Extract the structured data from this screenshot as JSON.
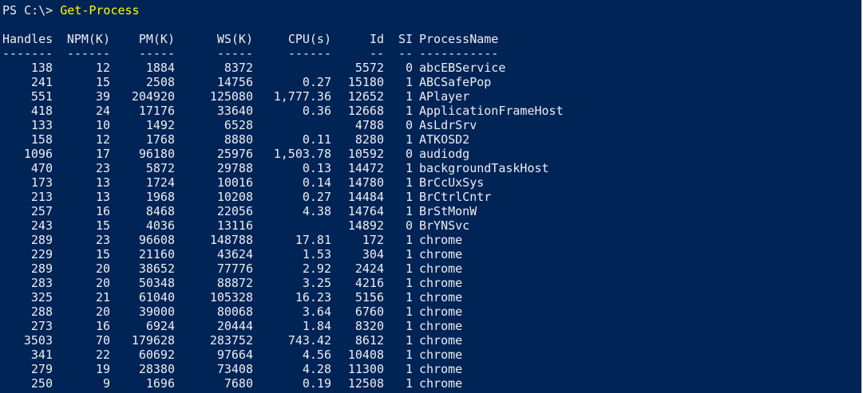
{
  "window": {
    "background": "#012456",
    "foreground": "#eeedf0",
    "command_color": "#ffff00"
  },
  "prompt": {
    "text": "PS C:\\> ",
    "command": "Get-Process"
  },
  "columns": {
    "handles": "Handles",
    "npm": "NPM(K)",
    "pm": "PM(K)",
    "ws": "WS(K)",
    "cpu": "CPU(s)",
    "id": "Id",
    "si": "SI",
    "name": "ProcessName"
  },
  "separators": {
    "handles": "-------",
    "npm": "------",
    "pm": "-----",
    "ws": "-----",
    "cpu": "------",
    "id": "--",
    "si": "--",
    "name": "-----------"
  },
  "rows": [
    {
      "handles": "138",
      "npm": "12",
      "pm": "1884",
      "ws": "8372",
      "cpu": "",
      "id": "5572",
      "si": "0",
      "name": "abcEBService"
    },
    {
      "handles": "241",
      "npm": "15",
      "pm": "2508",
      "ws": "14756",
      "cpu": "0.27",
      "id": "15180",
      "si": "1",
      "name": "ABCSafePop"
    },
    {
      "handles": "551",
      "npm": "39",
      "pm": "204920",
      "ws": "125080",
      "cpu": "1,777.36",
      "id": "12652",
      "si": "1",
      "name": "APlayer"
    },
    {
      "handles": "418",
      "npm": "24",
      "pm": "17176",
      "ws": "33640",
      "cpu": "0.36",
      "id": "12668",
      "si": "1",
      "name": "ApplicationFrameHost"
    },
    {
      "handles": "133",
      "npm": "10",
      "pm": "1492",
      "ws": "6528",
      "cpu": "",
      "id": "4788",
      "si": "0",
      "name": "AsLdrSrv"
    },
    {
      "handles": "158",
      "npm": "12",
      "pm": "1768",
      "ws": "8880",
      "cpu": "0.11",
      "id": "8280",
      "si": "1",
      "name": "ATKOSD2"
    },
    {
      "handles": "1096",
      "npm": "17",
      "pm": "96180",
      "ws": "25976",
      "cpu": "1,503.78",
      "id": "10592",
      "si": "0",
      "name": "audiodg"
    },
    {
      "handles": "470",
      "npm": "23",
      "pm": "5872",
      "ws": "29788",
      "cpu": "0.13",
      "id": "14472",
      "si": "1",
      "name": "backgroundTaskHost"
    },
    {
      "handles": "173",
      "npm": "13",
      "pm": "1724",
      "ws": "10016",
      "cpu": "0.14",
      "id": "14780",
      "si": "1",
      "name": "BrCcUxSys"
    },
    {
      "handles": "213",
      "npm": "13",
      "pm": "1968",
      "ws": "10208",
      "cpu": "0.27",
      "id": "14484",
      "si": "1",
      "name": "BrCtrlCntr"
    },
    {
      "handles": "257",
      "npm": "16",
      "pm": "8468",
      "ws": "22056",
      "cpu": "4.38",
      "id": "14764",
      "si": "1",
      "name": "BrStMonW"
    },
    {
      "handles": "243",
      "npm": "15",
      "pm": "4036",
      "ws": "13116",
      "cpu": "",
      "id": "14892",
      "si": "0",
      "name": "BrYNSvc"
    },
    {
      "handles": "289",
      "npm": "23",
      "pm": "96608",
      "ws": "148788",
      "cpu": "17.81",
      "id": "172",
      "si": "1",
      "name": "chrome"
    },
    {
      "handles": "229",
      "npm": "15",
      "pm": "21160",
      "ws": "43624",
      "cpu": "1.53",
      "id": "304",
      "si": "1",
      "name": "chrome"
    },
    {
      "handles": "289",
      "npm": "20",
      "pm": "38652",
      "ws": "77776",
      "cpu": "2.92",
      "id": "2424",
      "si": "1",
      "name": "chrome"
    },
    {
      "handles": "283",
      "npm": "20",
      "pm": "50348",
      "ws": "88872",
      "cpu": "3.25",
      "id": "4216",
      "si": "1",
      "name": "chrome"
    },
    {
      "handles": "325",
      "npm": "21",
      "pm": "61040",
      "ws": "105328",
      "cpu": "16.23",
      "id": "5156",
      "si": "1",
      "name": "chrome"
    },
    {
      "handles": "288",
      "npm": "20",
      "pm": "39000",
      "ws": "80068",
      "cpu": "3.64",
      "id": "6760",
      "si": "1",
      "name": "chrome"
    },
    {
      "handles": "273",
      "npm": "16",
      "pm": "6924",
      "ws": "20444",
      "cpu": "1.84",
      "id": "8320",
      "si": "1",
      "name": "chrome"
    },
    {
      "handles": "3503",
      "npm": "70",
      "pm": "179628",
      "ws": "283752",
      "cpu": "743.42",
      "id": "8612",
      "si": "1",
      "name": "chrome"
    },
    {
      "handles": "341",
      "npm": "22",
      "pm": "60692",
      "ws": "97664",
      "cpu": "4.56",
      "id": "10408",
      "si": "1",
      "name": "chrome"
    },
    {
      "handles": "279",
      "npm": "19",
      "pm": "28380",
      "ws": "73408",
      "cpu": "4.28",
      "id": "11300",
      "si": "1",
      "name": "chrome"
    },
    {
      "handles": "250",
      "npm": "9",
      "pm": "1696",
      "ws": "7680",
      "cpu": "0.19",
      "id": "12508",
      "si": "1",
      "name": "chrome"
    }
  ]
}
